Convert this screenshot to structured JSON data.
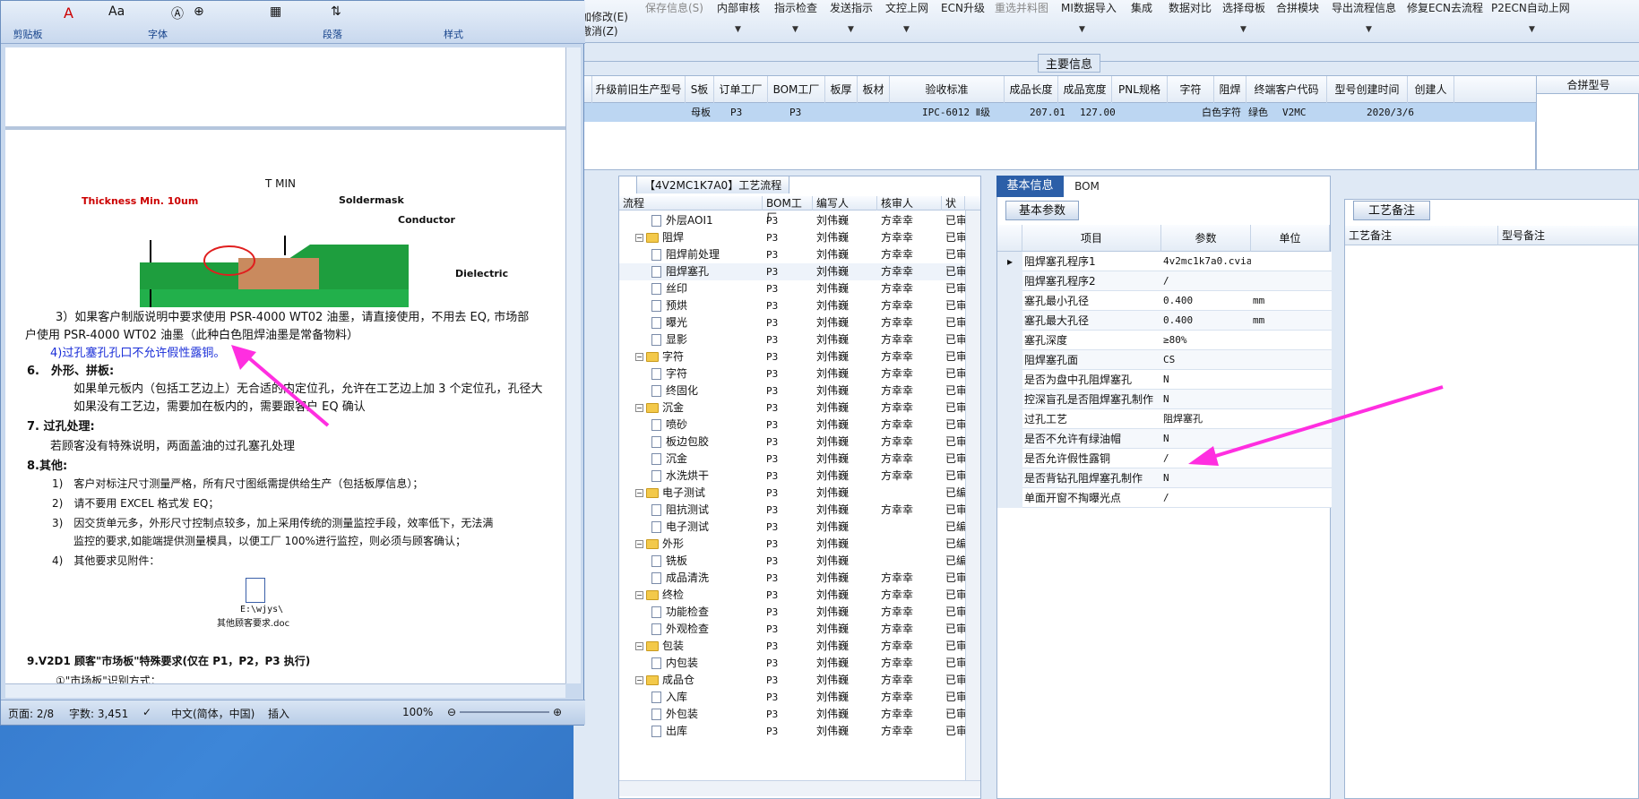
{
  "toolbar": {
    "row1": [
      "保存信息(S)",
      "内部审核",
      "指示检查",
      "发送指示",
      "文控上网",
      "ECN升级",
      "重选并料图",
      "MI数据导入",
      "集成",
      "数据对比",
      "选择母板",
      "合拼模块",
      "导出流程信息",
      "修复ECN去流程",
      "P2ECN自动上网"
    ],
    "modify_label": "加修改(E)",
    "cancel_label": "撤消(Z)"
  },
  "main_info_title": "主要信息",
  "grid": {
    "headers": [
      "升级前旧生产型号",
      "S板",
      "订单工厂",
      "BOM工厂",
      "板厚",
      "板材",
      "验收标准",
      "成品长度",
      "成品宽度",
      "PNL规格",
      "字符",
      "阻焊",
      "终端客户代码",
      "型号创建时间",
      "创建人"
    ],
    "row": [
      "",
      "母板",
      "P3",
      "P3",
      "",
      "",
      "IPC-6012 Ⅱ级",
      "207.01",
      "127.00",
      "",
      "白色字符",
      "绿色",
      "V2MC",
      "2020/3/6",
      ""
    ],
    "merge_header": "合拼型号"
  },
  "process": {
    "tab_label": "【4V2MC1K7A0】工艺流程",
    "headers": [
      "流程",
      "BOM工厂",
      "编写人",
      "核审人",
      "状态"
    ],
    "rows": [
      {
        "level": 1,
        "type": "file",
        "name": "外层AOI1",
        "bom": "P3",
        "writer": "刘伟巍",
        "reviewer": "方幸幸",
        "status": "已审核"
      },
      {
        "level": 0,
        "type": "folder",
        "name": "阻焊",
        "bom": "P3",
        "writer": "刘伟巍",
        "reviewer": "方幸幸",
        "status": "已审核"
      },
      {
        "level": 1,
        "type": "file",
        "name": "阻焊前处理",
        "bom": "P3",
        "writer": "刘伟巍",
        "reviewer": "方幸幸",
        "status": "已审核"
      },
      {
        "level": 1,
        "type": "file",
        "name": "阻焊塞孔",
        "bom": "P3",
        "writer": "刘伟巍",
        "reviewer": "方幸幸",
        "status": "已审核"
      },
      {
        "level": 1,
        "type": "file",
        "name": "丝印",
        "bom": "P3",
        "writer": "刘伟巍",
        "reviewer": "方幸幸",
        "status": "已审核"
      },
      {
        "level": 1,
        "type": "file",
        "name": "预烘",
        "bom": "P3",
        "writer": "刘伟巍",
        "reviewer": "方幸幸",
        "status": "已审核"
      },
      {
        "level": 1,
        "type": "file",
        "name": "曝光",
        "bom": "P3",
        "writer": "刘伟巍",
        "reviewer": "方幸幸",
        "status": "已审核"
      },
      {
        "level": 1,
        "type": "file",
        "name": "显影",
        "bom": "P3",
        "writer": "刘伟巍",
        "reviewer": "方幸幸",
        "status": "已审核"
      },
      {
        "level": 0,
        "type": "folder",
        "name": "字符",
        "bom": "P3",
        "writer": "刘伟巍",
        "reviewer": "方幸幸",
        "status": "已审核"
      },
      {
        "level": 1,
        "type": "file",
        "name": "字符",
        "bom": "P3",
        "writer": "刘伟巍",
        "reviewer": "方幸幸",
        "status": "已审核"
      },
      {
        "level": 1,
        "type": "file",
        "name": "终固化",
        "bom": "P3",
        "writer": "刘伟巍",
        "reviewer": "方幸幸",
        "status": "已审核"
      },
      {
        "level": 0,
        "type": "folder",
        "name": "沉金",
        "bom": "P3",
        "writer": "刘伟巍",
        "reviewer": "方幸幸",
        "status": "已审核"
      },
      {
        "level": 1,
        "type": "file",
        "name": "喷砂",
        "bom": "P3",
        "writer": "刘伟巍",
        "reviewer": "方幸幸",
        "status": "已审核"
      },
      {
        "level": 1,
        "type": "file",
        "name": "板边包胶",
        "bom": "P3",
        "writer": "刘伟巍",
        "reviewer": "方幸幸",
        "status": "已审核"
      },
      {
        "level": 1,
        "type": "file",
        "name": "沉金",
        "bom": "P3",
        "writer": "刘伟巍",
        "reviewer": "方幸幸",
        "status": "已审核"
      },
      {
        "level": 1,
        "type": "file",
        "name": "水洗烘干",
        "bom": "P3",
        "writer": "刘伟巍",
        "reviewer": "方幸幸",
        "status": "已审核"
      },
      {
        "level": 0,
        "type": "folder",
        "name": "电子测试",
        "bom": "P3",
        "writer": "刘伟巍",
        "reviewer": "",
        "status": "已编写"
      },
      {
        "level": 1,
        "type": "file",
        "name": "阻抗测试",
        "bom": "P3",
        "writer": "刘伟巍",
        "reviewer": "方幸幸",
        "status": "已审核"
      },
      {
        "level": 1,
        "type": "file",
        "name": "电子测试",
        "bom": "P3",
        "writer": "刘伟巍",
        "reviewer": "",
        "status": "已编写"
      },
      {
        "level": 0,
        "type": "folder",
        "name": "外形",
        "bom": "P3",
        "writer": "刘伟巍",
        "reviewer": "",
        "status": "已编写"
      },
      {
        "level": 1,
        "type": "file",
        "name": "铣板",
        "bom": "P3",
        "writer": "刘伟巍",
        "reviewer": "",
        "status": "已编写"
      },
      {
        "level": 1,
        "type": "file",
        "name": "成品清洗",
        "bom": "P3",
        "writer": "刘伟巍",
        "reviewer": "方幸幸",
        "status": "已审核"
      },
      {
        "level": 0,
        "type": "folder",
        "name": "终检",
        "bom": "P3",
        "writer": "刘伟巍",
        "reviewer": "方幸幸",
        "status": "已审核"
      },
      {
        "level": 1,
        "type": "file",
        "name": "功能检查",
        "bom": "P3",
        "writer": "刘伟巍",
        "reviewer": "方幸幸",
        "status": "已审核"
      },
      {
        "level": 1,
        "type": "file",
        "name": "外观检查",
        "bom": "P3",
        "writer": "刘伟巍",
        "reviewer": "方幸幸",
        "status": "已审核"
      },
      {
        "level": 0,
        "type": "folder",
        "name": "包装",
        "bom": "P3",
        "writer": "刘伟巍",
        "reviewer": "方幸幸",
        "status": "已审核"
      },
      {
        "level": 1,
        "type": "file",
        "name": "内包装",
        "bom": "P3",
        "writer": "刘伟巍",
        "reviewer": "方幸幸",
        "status": "已审核"
      },
      {
        "level": 0,
        "type": "folder",
        "name": "成品仓",
        "bom": "P3",
        "writer": "刘伟巍",
        "reviewer": "方幸幸",
        "status": "已审核"
      },
      {
        "level": 1,
        "type": "file",
        "name": "入库",
        "bom": "P3",
        "writer": "刘伟巍",
        "reviewer": "方幸幸",
        "status": "已审核"
      },
      {
        "level": 1,
        "type": "file",
        "name": "外包装",
        "bom": "P3",
        "writer": "刘伟巍",
        "reviewer": "方幸幸",
        "status": "已审核"
      },
      {
        "level": 1,
        "type": "file",
        "name": "出库",
        "bom": "P3",
        "writer": "刘伟巍",
        "reviewer": "方幸幸",
        "status": "已审核"
      }
    ]
  },
  "basic": {
    "tab1": "基本信息",
    "tab2": "BOM",
    "param_tab": "基本参数",
    "headers": [
      "项目",
      "参数",
      "单位"
    ],
    "rows": [
      {
        "item": "阻焊塞孔程序1",
        "value": "4v2mc1k7a0.cvia",
        "unit": ""
      },
      {
        "item": "阻焊塞孔程序2",
        "value": "/",
        "unit": ""
      },
      {
        "item": "塞孔最小孔径",
        "value": "0.400",
        "unit": "mm"
      },
      {
        "item": "塞孔最大孔径",
        "value": "0.400",
        "unit": "mm"
      },
      {
        "item": "塞孔深度",
        "value": "≥80%",
        "unit": ""
      },
      {
        "item": "阻焊塞孔面",
        "value": "CS",
        "unit": ""
      },
      {
        "item": "是否为盘中孔阻焊塞孔",
        "value": "N",
        "unit": ""
      },
      {
        "item": "控深盲孔是否阻焊塞孔制作",
        "value": "N",
        "unit": ""
      },
      {
        "item": "过孔工艺",
        "value": "阻焊塞孔",
        "unit": ""
      },
      {
        "item": "是否不允许有绿油帽",
        "value": "N",
        "unit": ""
      },
      {
        "item": "是否允许假性露铜",
        "value": "/",
        "unit": ""
      },
      {
        "item": "是否背钻孔阻焊塞孔制作",
        "value": "N",
        "unit": ""
      },
      {
        "item": "单面开窗不掏曝光点",
        "value": "/",
        "unit": ""
      }
    ]
  },
  "notes": {
    "tab": "工艺备注",
    "col1": "工艺备注",
    "col2": "型号备注"
  },
  "word": {
    "groups": [
      "剪贴板",
      "字体",
      "段落",
      "样式"
    ],
    "diagram": {
      "tmin": "T MIN",
      "thickness": "Thickness Min. 10um",
      "soldermask": "Soldermask",
      "conductor": "Conductor",
      "dielectric": "Dielectric"
    },
    "lines": [
      "3）如果客户制版说明中要求使用 PSR-4000 WT02 油墨，请直接使用，不用去 EQ, 市场部",
      "户使用 PSR-4000 WT02 油墨（此种白色阻焊油墨是常备物料）",
      "4)过孔塞孔孔口不允许假性露铜。",
      "6.　外形、拼板:",
      "如果单元板内（包括工艺边上）无合适的内定位孔，允许在工艺边上加 3 个定位孔，孔径大",
      "如果没有工艺边，需要加在板内的，需要跟客户 EQ 确认",
      "7. 过孔处理:",
      "若顾客没有特殊说明，两面盖油的过孔塞孔处理",
      "8.其他:",
      "1)　客户对标注尺寸测量严格，所有尺寸图纸需提供给生产（包括板厚信息）；",
      "2)　请不要用 EXCEL 格式发 EQ；",
      "3)　因交货单元多，外形尺寸控制点较多，加上采用传统的测量监控手段，效率低下，无法满",
      "监控的要求,如能端提供测量模具，以便工厂 100%进行监控，则必须与顾客确认；",
      "4)　其他要求见附件：",
      "E:\\wjys\\",
      "其他顾客要求.doc",
      "9.V2D1 顾客\"市场板\"特殊要求(仅在 P1，P2，P3 执行)",
      "①\"市场板\"识别方式："
    ],
    "status": {
      "page": "页面: 2/8",
      "words": "字数: 3,451",
      "lang": "中文(简体，中国)",
      "mode": "插入",
      "zoom": "100%"
    }
  },
  "colors": {
    "accent": "#2c5fa8",
    "row_select": "#bcd6f2",
    "arrow": "#ff2ee0",
    "link_text": "#1a2ed8"
  }
}
